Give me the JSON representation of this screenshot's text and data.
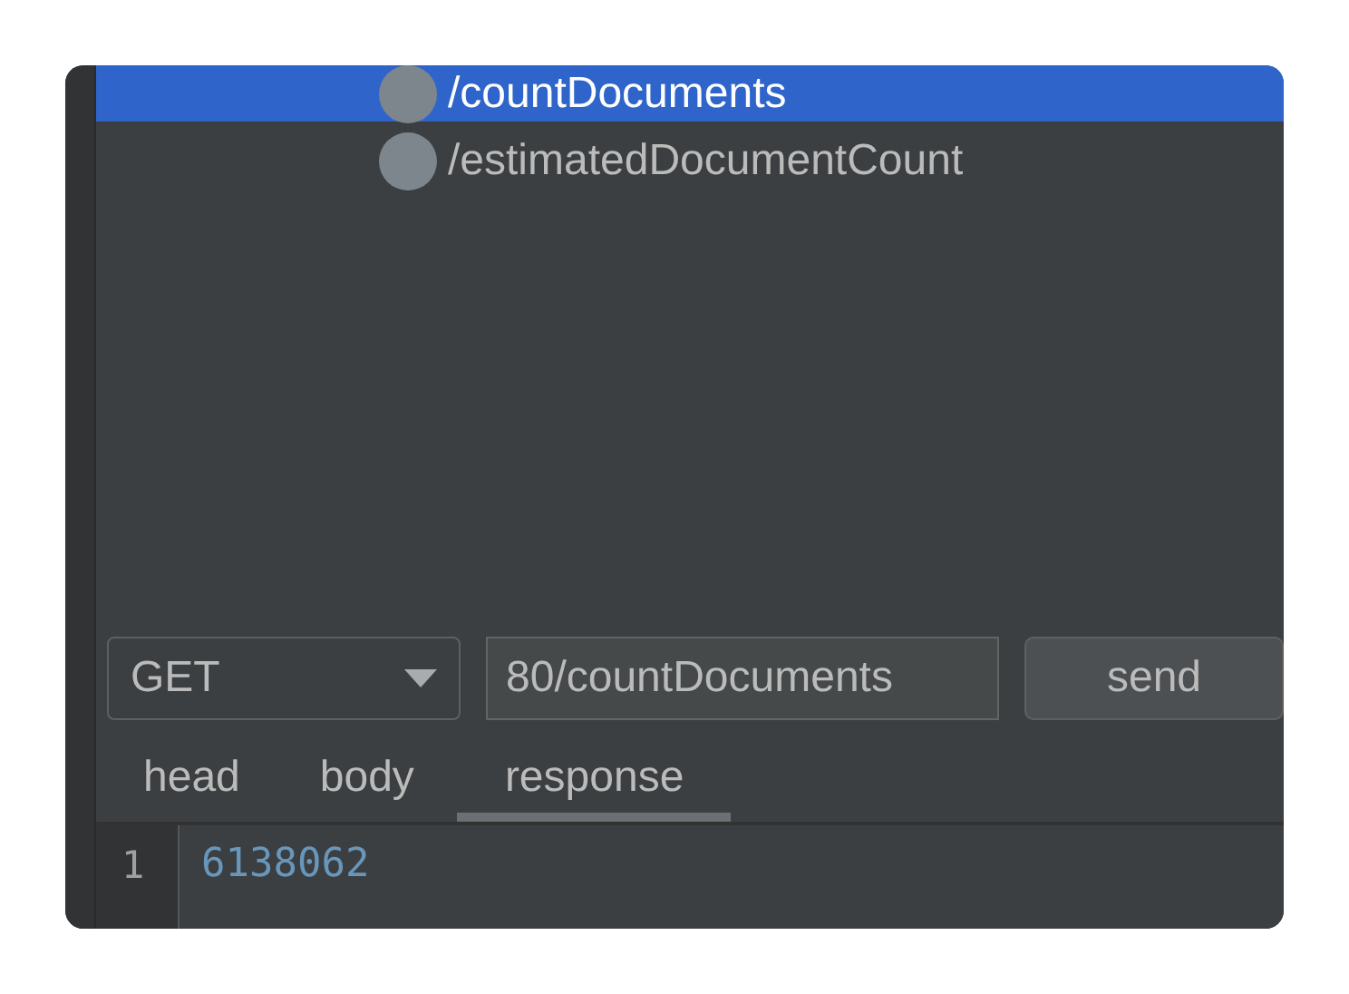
{
  "endpoints": [
    {
      "label": "/countDocuments",
      "selected": true
    },
    {
      "label": "/estimatedDocumentCount",
      "selected": false
    }
  ],
  "request": {
    "method": "GET",
    "url": "80/countDocuments",
    "send_button": "send"
  },
  "tabs": [
    {
      "label": "head",
      "selected": false
    },
    {
      "label": "body",
      "selected": false
    },
    {
      "label": "response",
      "selected": true
    }
  ],
  "response": {
    "lines": [
      {
        "number": "1",
        "text": "6138062"
      }
    ]
  }
}
